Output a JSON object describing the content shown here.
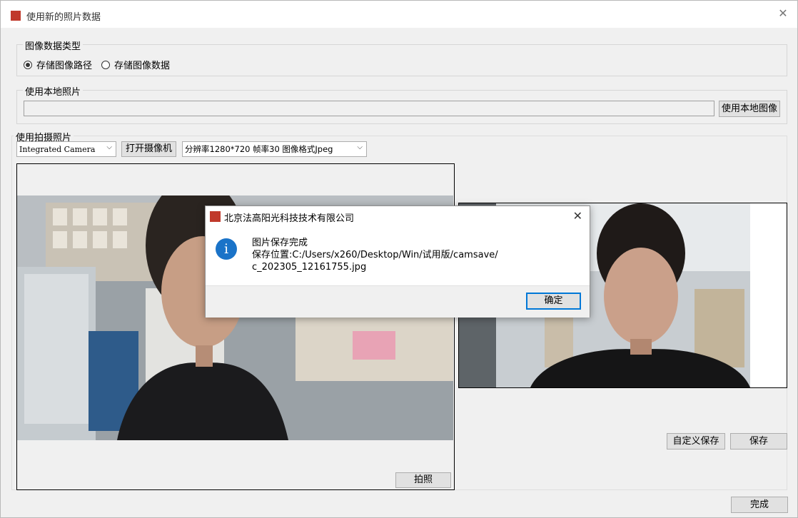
{
  "window": {
    "title": "使用新的照片数据",
    "close_glyph": "✕",
    "icon_text": "Fagao"
  },
  "image_type": {
    "group_title": "图像数据类型",
    "options": [
      {
        "label": "存储图像路径",
        "selected": true
      },
      {
        "label": "存储图像数据",
        "selected": false
      }
    ]
  },
  "local_photo": {
    "group_title": "使用本地照片",
    "path_value": "",
    "button_label": "使用本地图像"
  },
  "camera": {
    "group_title": "使用拍摄照片",
    "device_selected": "Integrated Camera",
    "open_button": "打开摄像机",
    "format_selected": "分辨率1280*720 帧率30 图像格式Jpeg",
    "capture_button": "拍照",
    "custom_save_button": "自定义保存",
    "save_button": "保存"
  },
  "footer": {
    "done_button": "完成"
  },
  "dialog": {
    "title": "北京法高阳光科技技术有限公司",
    "close_glyph": "✕",
    "info_glyph": "i",
    "message_line1": "图片保存完成",
    "message_line2": "保存位置:C:/Users/x260/Desktop/Win/试用版/camsave/",
    "message_line3": "c_202305_12161755.jpg",
    "ok_button": "确定"
  },
  "colors": {
    "accent": "#0078d7",
    "brand": "#c0392b",
    "info": "#1a73c8"
  }
}
